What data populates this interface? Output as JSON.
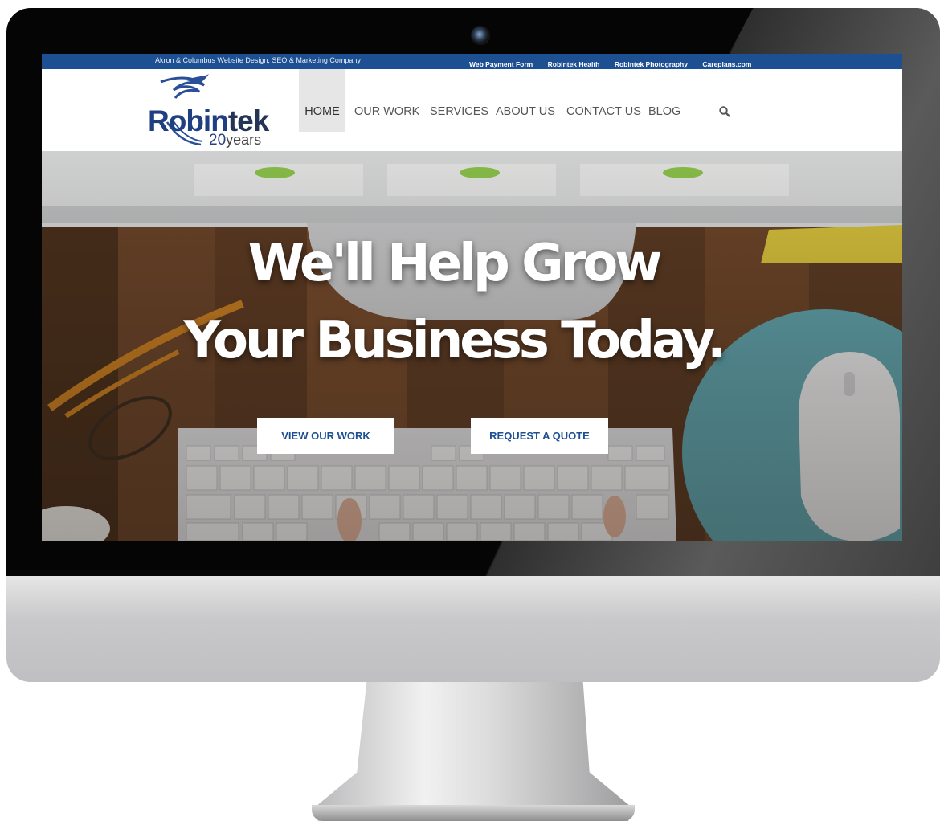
{
  "topbar": {
    "tagline": "Akron & Columbus Website Design, SEO & Marketing Company",
    "links": [
      "Web Payment Form",
      "Robintek Health",
      "Robintek Photography",
      "Careplans.com"
    ]
  },
  "logo": {
    "text_part1": "Robin",
    "text_part2": "tek",
    "years_number": "20",
    "years_word": "years"
  },
  "nav": {
    "items": [
      "HOME",
      "OUR WORK",
      "SERVICES",
      "ABOUT US",
      "CONTACT US",
      "BLOG"
    ],
    "active": "HOME",
    "search_icon": "search-icon"
  },
  "hero": {
    "title_line1": "We'll Help Grow",
    "title_line2": "Your Business Today.",
    "buttons": [
      "VIEW OUR WORK",
      "REQUEST A QUOTE"
    ]
  },
  "colors": {
    "brand_blue": "#1d4f93",
    "nav_active_bg": "#e6e6e6"
  }
}
